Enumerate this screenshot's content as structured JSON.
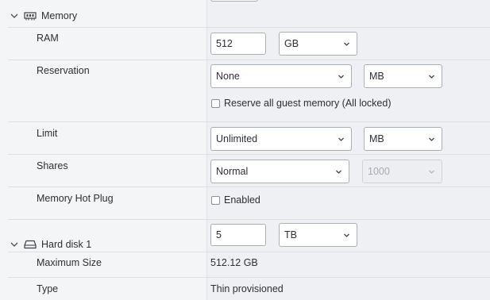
{
  "memory": {
    "header": "Memory",
    "ram": {
      "label": "RAM",
      "value": "512",
      "unit": "GB"
    },
    "reservation": {
      "label": "Reservation",
      "value": "None",
      "unit": "MB",
      "checkbox_label": "Reserve all guest memory (All locked)"
    },
    "limit": {
      "label": "Limit",
      "value": "Unlimited",
      "unit": "MB"
    },
    "shares": {
      "label": "Shares",
      "value": "Normal",
      "amount": "1000"
    },
    "hot_plug": {
      "label": "Memory Hot Plug",
      "checkbox_label": "Enabled"
    }
  },
  "hard_disk": {
    "header": "Hard disk 1",
    "size": {
      "value": "5",
      "unit": "TB"
    },
    "max_size": {
      "label": "Maximum Size",
      "value": "512.12 GB"
    },
    "type": {
      "label": "Type",
      "value": "Thin provisioned"
    }
  },
  "icons": {
    "chevron": "chevron-down-icon",
    "memory": "memory-chip-icon",
    "disk": "hard-disk-icon",
    "caret": "caret-down-icon"
  }
}
